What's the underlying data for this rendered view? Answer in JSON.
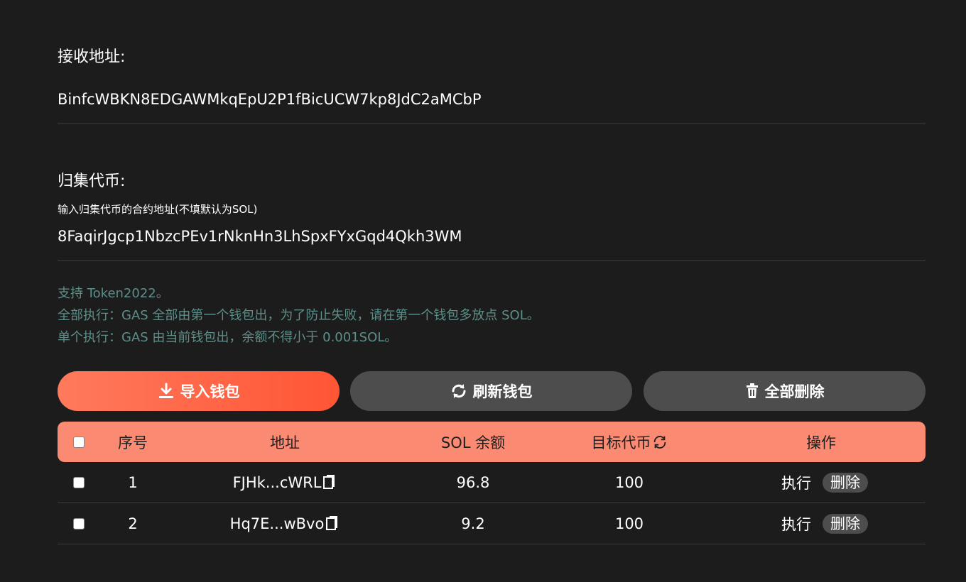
{
  "receive": {
    "label": "接收地址:",
    "value": "BinfcWBKN8EDGAWMkqEpU2P1fBicUCW7kp8JdC2aMCbP"
  },
  "token": {
    "label": "归集代币:",
    "hint": "输入归集代币的合约地址(不填默认为SOL)",
    "value": "8FaqirJgcp1NbzcPEv1rNknHn3LhSpxFYxGqd4Qkh3WM"
  },
  "notes": [
    "支持 Token2022。",
    "全部执行：GAS 全部由第一个钱包出，为了防止失败，请在第一个钱包多放点 SOL。",
    "单个执行：GAS 由当前钱包出，余额不得小于 0.001SOL。"
  ],
  "buttons": {
    "import": "导入钱包",
    "refresh": "刷新钱包",
    "delete_all": "全部删除"
  },
  "table": {
    "headers": {
      "index": "序号",
      "address": "地址",
      "sol_balance": "SOL 余额",
      "target_token": "目标代币",
      "actions": "操作"
    },
    "rows": [
      {
        "index": "1",
        "address": "FJHk...cWRL",
        "sol": "96.8",
        "target": "100",
        "execute": "执行",
        "delete": "删除"
      },
      {
        "index": "2",
        "address": "Hq7E...wBvo",
        "sol": "9.2",
        "target": "100",
        "execute": "执行",
        "delete": "删除"
      }
    ]
  },
  "colors": {
    "background": "#1c1c1c",
    "accent": "#ff5535",
    "header_row": "#fb8a72",
    "note_text": "#5d8f8a",
    "dark_button": "#4d4d4d"
  }
}
